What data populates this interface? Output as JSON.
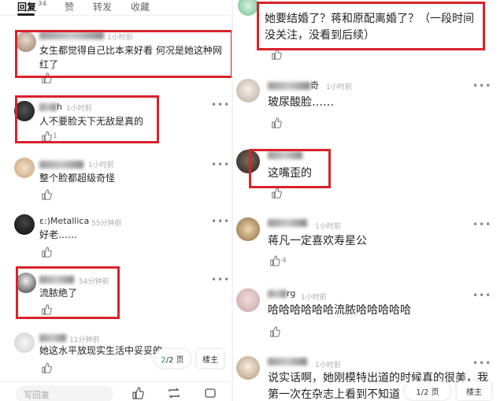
{
  "tabs": [
    {
      "label": "回复",
      "count": "34"
    },
    {
      "label": "赞",
      "count": ""
    },
    {
      "label": "转发",
      "count": ""
    },
    {
      "label": "收藏",
      "count": ""
    }
  ],
  "left": {
    "comments": [
      {
        "user": "",
        "time": "1小时前",
        "text": "女生都觉得自己比本来好看 何况是她这种网红了",
        "likes": ""
      },
      {
        "user": "h",
        "time": "1小时前",
        "text": "人不要脸天下无敌是真的",
        "likes": "1"
      },
      {
        "user": "",
        "time": "1小时前",
        "text": "整个脸都超级奇怪",
        "likes": ""
      },
      {
        "user": "ε:)Metallica",
        "time": "55分钟前",
        "text": "好老……",
        "likes": ""
      },
      {
        "user": "",
        "time": "54分钟前",
        "text": "流脓绝了",
        "likes": ""
      },
      {
        "user": "",
        "time": "11分钟前",
        "text": "她这水平放现实生活中妥妥的",
        "likes": ""
      }
    ],
    "reply_placeholder": "写回复",
    "pager_current": "2",
    "pager_total": "/2 页",
    "owner_label": "楼主"
  },
  "right": {
    "comments": [
      {
        "user": "",
        "time": "",
        "text": "她要结婚了？蒋和原配离婚了？（一段时间没关注，没看到后续）",
        "likes": ""
      },
      {
        "user": "奇",
        "time": "1小时前",
        "text": "玻尿酸脸……",
        "likes": ""
      },
      {
        "user": "",
        "time": "",
        "text": "这嘴歪的",
        "likes": ""
      },
      {
        "user": "",
        "time": "1小时前",
        "text": "蒋凡一定喜欢寿星公",
        "likes": "4"
      },
      {
        "user": "rg",
        "time": "1小时前",
        "text": "哈哈哈哈哈哈流脓哈哈哈哈哈",
        "likes": ""
      },
      {
        "user": "",
        "time": "1小时前",
        "text": "说实话啊，她刚模特出道的时候真的很美，我第一次在杂志上看到不知道",
        "likes": ""
      }
    ],
    "pager": "1/2 页",
    "owner_label": "楼主"
  },
  "colors": {
    "highlight": "#d9222a",
    "pager_accent": "#2a9d4a"
  }
}
